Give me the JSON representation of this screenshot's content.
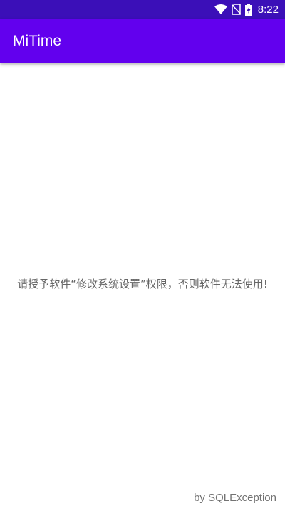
{
  "status_bar": {
    "time": "8:22",
    "icons": [
      "wifi-icon",
      "no-sim-icon",
      "battery-charging-icon"
    ],
    "color": "#3b0fb8"
  },
  "app_bar": {
    "title": "MiTime",
    "color": "#6200ee"
  },
  "content": {
    "message": "请授予软件“修改系统设置”权限，否则软件无法使用!"
  },
  "footer": {
    "credit": "by SQLException"
  }
}
